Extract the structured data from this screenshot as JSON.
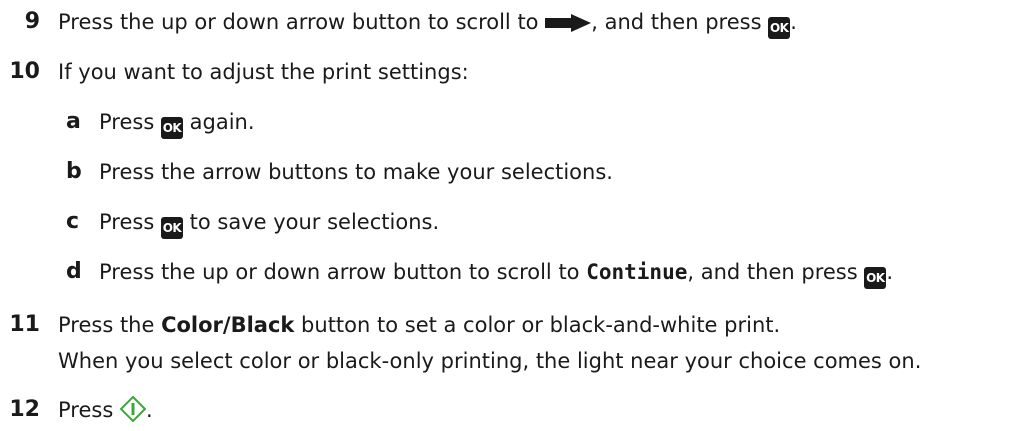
{
  "steps": [
    {
      "num": "9",
      "pre": "Press the up or down arrow button to scroll to ",
      "mid": ", and then press ",
      "end": "."
    },
    {
      "num": "10",
      "text": "If you want to adjust the print settings:"
    },
    {
      "num": "11",
      "pre": "Press the ",
      "bold": "Color/Black",
      "post": " button to set a color or black-and-white print.",
      "note": "When you select color or black-only printing, the light near your choice comes on."
    },
    {
      "num": "12",
      "pre": "Press ",
      "end": "."
    }
  ],
  "substeps": [
    {
      "letter": "a",
      "pre": "Press ",
      "post": " again."
    },
    {
      "letter": "b",
      "text": "Press the arrow buttons to make your selections."
    },
    {
      "letter": "c",
      "pre": "Press ",
      "post": " to save your selections."
    },
    {
      "letter": "d",
      "pre": "Press the up or down arrow button to scroll to ",
      "mono": "Continue",
      "mid": ", and then press ",
      "end": "."
    }
  ],
  "ok_label": "OK",
  "icons": {
    "arrow": "right-arrow-icon",
    "start": "start-button-icon"
  },
  "colors": {
    "start_icon": "#3aa835",
    "ok_bg": "#1a1a1a"
  }
}
